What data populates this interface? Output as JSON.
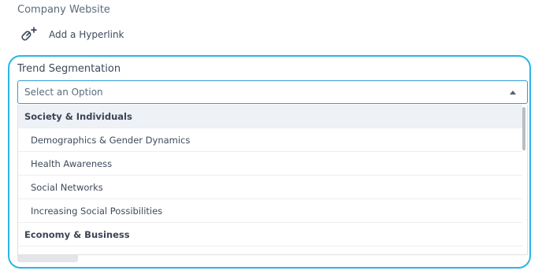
{
  "company_website": {
    "label": "Company Website",
    "add_hyperlink_label": "Add a Hyperlink",
    "link_icon": "link-plus-icon"
  },
  "trend_segmentation": {
    "label": "Trend Segmentation",
    "placeholder": "Select an Option",
    "options": [
      {
        "label": "Society & Individuals",
        "type": "group",
        "highlighted": true
      },
      {
        "label": "Demographics & Gender Dynamics",
        "type": "item"
      },
      {
        "label": "Health Awareness",
        "type": "item"
      },
      {
        "label": "Social Networks",
        "type": "item"
      },
      {
        "label": "Increasing Social Possibilities",
        "type": "item"
      },
      {
        "label": "Economy & Business",
        "type": "group"
      }
    ]
  },
  "colors": {
    "focus_outline": "#2ab6e6",
    "select_border": "#2e9bd6",
    "group_highlight": "#eef1f5"
  }
}
